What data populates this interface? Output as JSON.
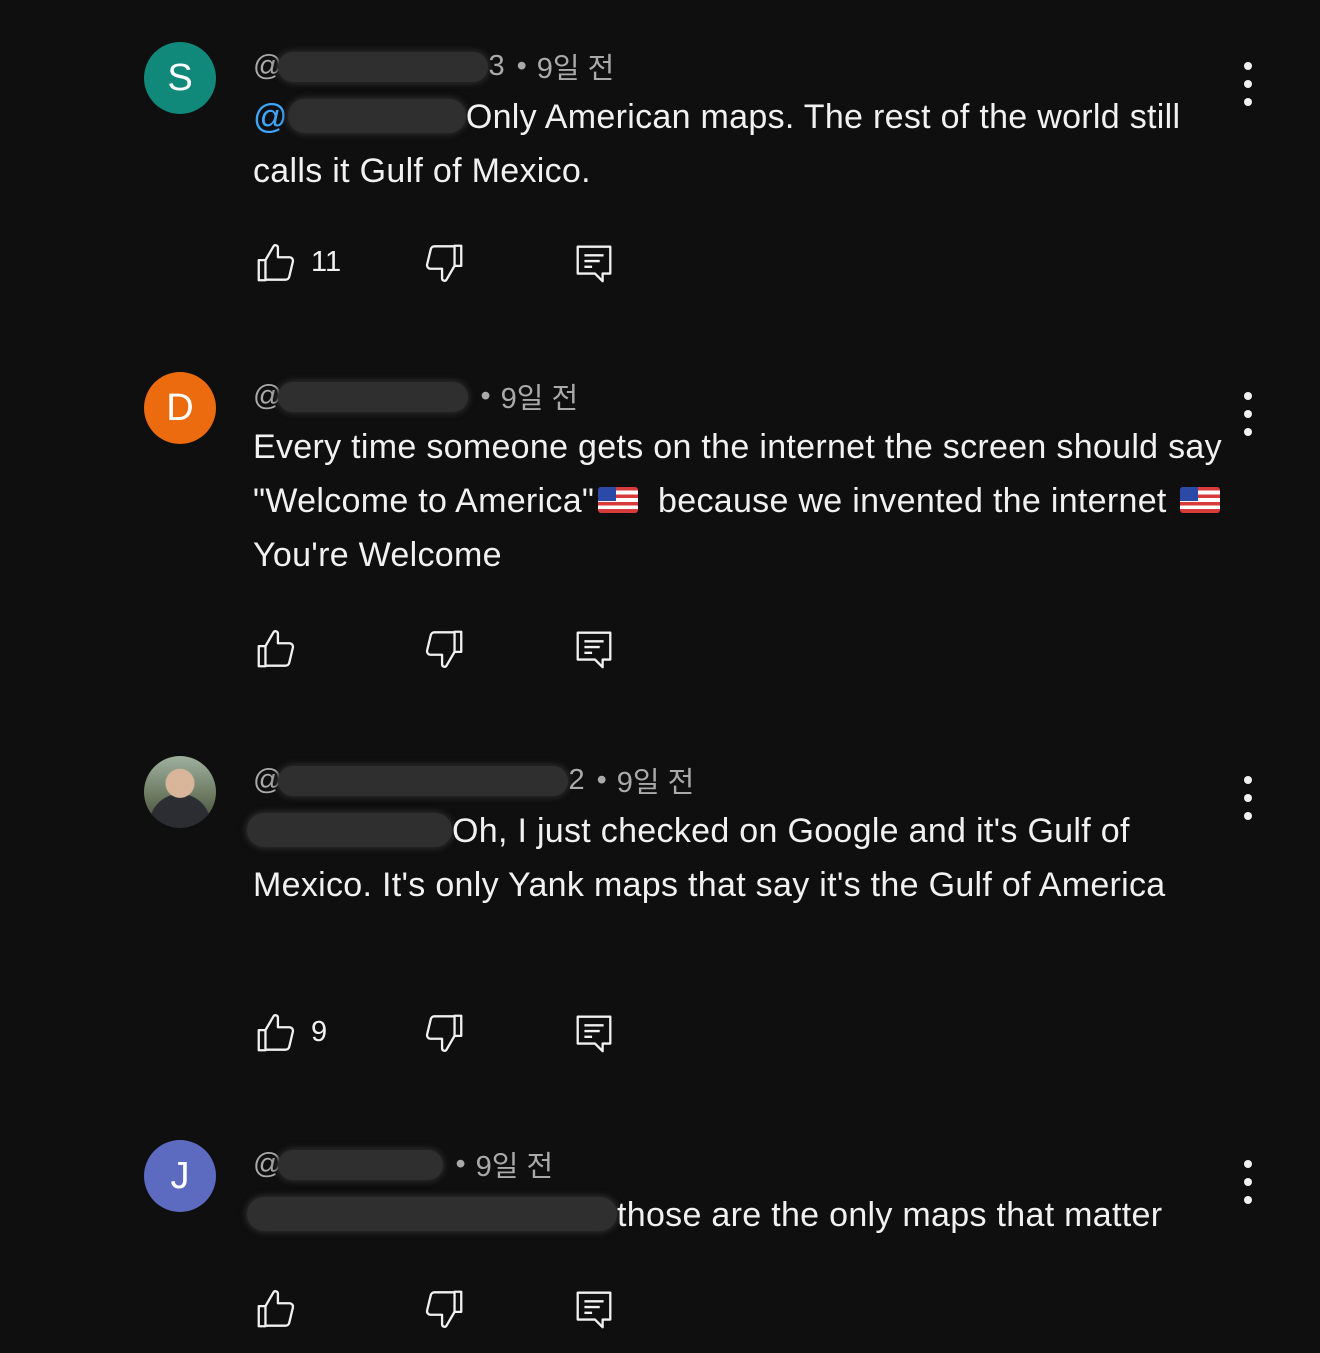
{
  "comments": [
    {
      "avatar_letter": "S",
      "avatar_color": "#11897a",
      "handle_prefix": "@",
      "handle_suffix": "3",
      "time": "9일 전",
      "mention_prefix": "@",
      "text": "Only American maps. The rest of the world still calls it Gulf of Mexico.",
      "likes": "11"
    },
    {
      "avatar_letter": "D",
      "avatar_color": "#ec6b0f",
      "handle_prefix": "@",
      "handle_suffix": "",
      "time": "9일 전",
      "text_part1": "Every time someone gets on the internet the screen should say \"Welcome to America\"",
      "text_part2": "because we invented the internet",
      "text_part3": "You're Welcome",
      "likes": ""
    },
    {
      "avatar_letter": "",
      "handle_prefix": "@",
      "handle_suffix": "2",
      "time": "9일 전",
      "mention_prefix": "",
      "text": "Oh, I just checked on Google and it's Gulf of Mexico. It's only Yank maps that say it's the Gulf of America",
      "likes": "9"
    },
    {
      "avatar_letter": "J",
      "avatar_color": "#5c6bc0",
      "handle_prefix": "@",
      "handle_suffix": "",
      "time": "9일 전",
      "mention_prefix": "",
      "text": "those are the only maps that matter",
      "likes": ""
    }
  ],
  "separator": "•",
  "icons": {
    "like": "thumbs-up-icon",
    "dislike": "thumbs-down-icon",
    "reply": "reply-comment-icon",
    "more": "more-vertical-icon",
    "flag": "us-flag-emoji"
  }
}
